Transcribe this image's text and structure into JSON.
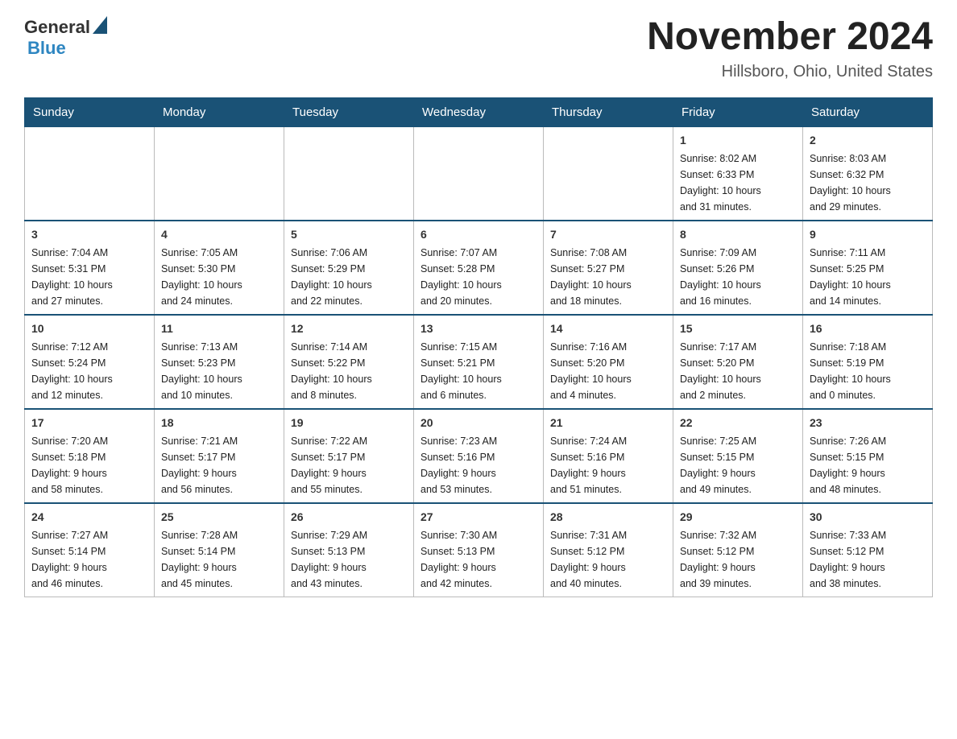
{
  "logo": {
    "general": "General",
    "blue": "Blue"
  },
  "title": "November 2024",
  "location": "Hillsboro, Ohio, United States",
  "weekdays": [
    "Sunday",
    "Monday",
    "Tuesday",
    "Wednesday",
    "Thursday",
    "Friday",
    "Saturday"
  ],
  "weeks": [
    [
      {
        "day": "",
        "info": ""
      },
      {
        "day": "",
        "info": ""
      },
      {
        "day": "",
        "info": ""
      },
      {
        "day": "",
        "info": ""
      },
      {
        "day": "",
        "info": ""
      },
      {
        "day": "1",
        "info": "Sunrise: 8:02 AM\nSunset: 6:33 PM\nDaylight: 10 hours\nand 31 minutes."
      },
      {
        "day": "2",
        "info": "Sunrise: 8:03 AM\nSunset: 6:32 PM\nDaylight: 10 hours\nand 29 minutes."
      }
    ],
    [
      {
        "day": "3",
        "info": "Sunrise: 7:04 AM\nSunset: 5:31 PM\nDaylight: 10 hours\nand 27 minutes."
      },
      {
        "day": "4",
        "info": "Sunrise: 7:05 AM\nSunset: 5:30 PM\nDaylight: 10 hours\nand 24 minutes."
      },
      {
        "day": "5",
        "info": "Sunrise: 7:06 AM\nSunset: 5:29 PM\nDaylight: 10 hours\nand 22 minutes."
      },
      {
        "day": "6",
        "info": "Sunrise: 7:07 AM\nSunset: 5:28 PM\nDaylight: 10 hours\nand 20 minutes."
      },
      {
        "day": "7",
        "info": "Sunrise: 7:08 AM\nSunset: 5:27 PM\nDaylight: 10 hours\nand 18 minutes."
      },
      {
        "day": "8",
        "info": "Sunrise: 7:09 AM\nSunset: 5:26 PM\nDaylight: 10 hours\nand 16 minutes."
      },
      {
        "day": "9",
        "info": "Sunrise: 7:11 AM\nSunset: 5:25 PM\nDaylight: 10 hours\nand 14 minutes."
      }
    ],
    [
      {
        "day": "10",
        "info": "Sunrise: 7:12 AM\nSunset: 5:24 PM\nDaylight: 10 hours\nand 12 minutes."
      },
      {
        "day": "11",
        "info": "Sunrise: 7:13 AM\nSunset: 5:23 PM\nDaylight: 10 hours\nand 10 minutes."
      },
      {
        "day": "12",
        "info": "Sunrise: 7:14 AM\nSunset: 5:22 PM\nDaylight: 10 hours\nand 8 minutes."
      },
      {
        "day": "13",
        "info": "Sunrise: 7:15 AM\nSunset: 5:21 PM\nDaylight: 10 hours\nand 6 minutes."
      },
      {
        "day": "14",
        "info": "Sunrise: 7:16 AM\nSunset: 5:20 PM\nDaylight: 10 hours\nand 4 minutes."
      },
      {
        "day": "15",
        "info": "Sunrise: 7:17 AM\nSunset: 5:20 PM\nDaylight: 10 hours\nand 2 minutes."
      },
      {
        "day": "16",
        "info": "Sunrise: 7:18 AM\nSunset: 5:19 PM\nDaylight: 10 hours\nand 0 minutes."
      }
    ],
    [
      {
        "day": "17",
        "info": "Sunrise: 7:20 AM\nSunset: 5:18 PM\nDaylight: 9 hours\nand 58 minutes."
      },
      {
        "day": "18",
        "info": "Sunrise: 7:21 AM\nSunset: 5:17 PM\nDaylight: 9 hours\nand 56 minutes."
      },
      {
        "day": "19",
        "info": "Sunrise: 7:22 AM\nSunset: 5:17 PM\nDaylight: 9 hours\nand 55 minutes."
      },
      {
        "day": "20",
        "info": "Sunrise: 7:23 AM\nSunset: 5:16 PM\nDaylight: 9 hours\nand 53 minutes."
      },
      {
        "day": "21",
        "info": "Sunrise: 7:24 AM\nSunset: 5:16 PM\nDaylight: 9 hours\nand 51 minutes."
      },
      {
        "day": "22",
        "info": "Sunrise: 7:25 AM\nSunset: 5:15 PM\nDaylight: 9 hours\nand 49 minutes."
      },
      {
        "day": "23",
        "info": "Sunrise: 7:26 AM\nSunset: 5:15 PM\nDaylight: 9 hours\nand 48 minutes."
      }
    ],
    [
      {
        "day": "24",
        "info": "Sunrise: 7:27 AM\nSunset: 5:14 PM\nDaylight: 9 hours\nand 46 minutes."
      },
      {
        "day": "25",
        "info": "Sunrise: 7:28 AM\nSunset: 5:14 PM\nDaylight: 9 hours\nand 45 minutes."
      },
      {
        "day": "26",
        "info": "Sunrise: 7:29 AM\nSunset: 5:13 PM\nDaylight: 9 hours\nand 43 minutes."
      },
      {
        "day": "27",
        "info": "Sunrise: 7:30 AM\nSunset: 5:13 PM\nDaylight: 9 hours\nand 42 minutes."
      },
      {
        "day": "28",
        "info": "Sunrise: 7:31 AM\nSunset: 5:12 PM\nDaylight: 9 hours\nand 40 minutes."
      },
      {
        "day": "29",
        "info": "Sunrise: 7:32 AM\nSunset: 5:12 PM\nDaylight: 9 hours\nand 39 minutes."
      },
      {
        "day": "30",
        "info": "Sunrise: 7:33 AM\nSunset: 5:12 PM\nDaylight: 9 hours\nand 38 minutes."
      }
    ]
  ]
}
